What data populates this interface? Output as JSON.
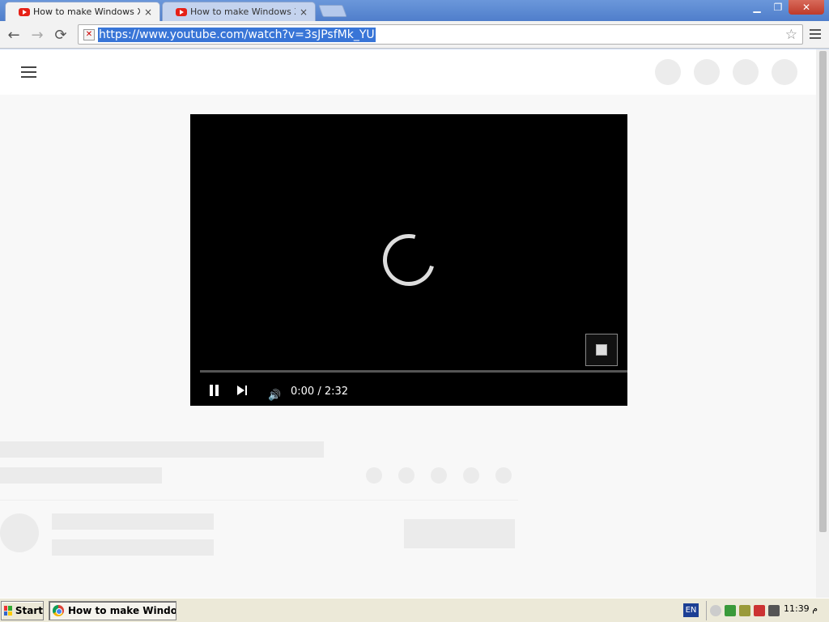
{
  "tabs": [
    {
      "title": "How to make Windows Xp loo",
      "close": "×"
    },
    {
      "title": "How to make Windows Xp loo",
      "close": "×"
    }
  ],
  "window": {
    "minimize": "▁",
    "restore": "❐",
    "close": "✕"
  },
  "toolbar": {
    "back": "←",
    "forward": "→",
    "reload": "⟳",
    "url": "https://www.youtube.com/watch?v=3sJPsfMk_YU",
    "star": "☆"
  },
  "player": {
    "timecode": "0:00 / 2:32",
    "volume": "🔊"
  },
  "taskbar": {
    "start": "Start",
    "task": "How to make Window...",
    "language": "EN",
    "clock": "11:39 م"
  },
  "colors": {
    "accent_selection": "#3875d7",
    "youtube_red": "#e62117",
    "taskbar": "#ece9d8",
    "placeholder": "#ebebeb"
  }
}
